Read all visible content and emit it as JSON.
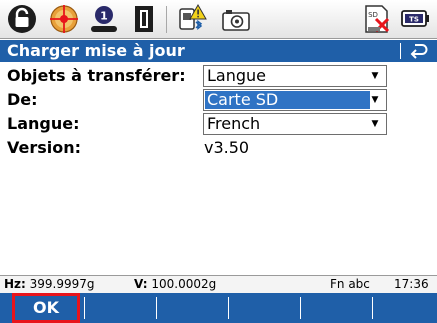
{
  "toolbar": {
    "icons": [
      "lock-icon",
      "prism-target-icon",
      "level-bubble-icon",
      "instrument-icon",
      "bluetooth-warning-icon",
      "camera-icon",
      "sd-card-icon",
      "battery-icon"
    ],
    "battery_text": "TS",
    "sd_text": "SD"
  },
  "titlebar": {
    "title": "Charger mise à jour",
    "back_icon": "return-arrow-icon"
  },
  "form": {
    "objects": {
      "label": "Objets à transférer:",
      "value": "Langue"
    },
    "from": {
      "label": "De:",
      "value": "Carte SD"
    },
    "language": {
      "label": "Langue:",
      "value": "French"
    },
    "version": {
      "label": "Version:",
      "value": "v3.50"
    }
  },
  "statusbar": {
    "hz_label": "Hz:",
    "hz_value": "399.9997g",
    "v_label": "V:",
    "v_value": "100.0002g",
    "mode": "Fn abc",
    "time": "17:36"
  },
  "softkeys": {
    "ok_label": "OK",
    "highlight_color": "#e8141b"
  },
  "colors": {
    "accent": "#1f5fa8",
    "selection": "#2f73c4"
  }
}
